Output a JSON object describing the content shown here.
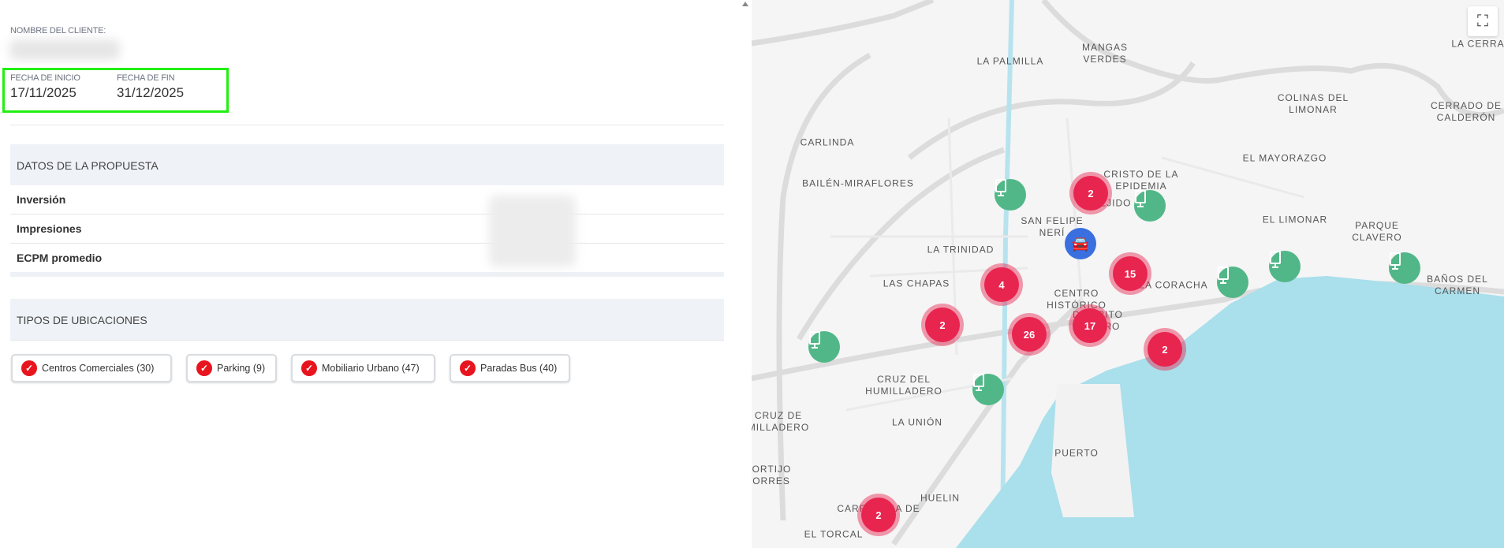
{
  "client": {
    "label": "NOMBRE DEL CLIENTE:"
  },
  "dates": {
    "start_label": "FECHA DE INICIO",
    "start_value": "17/11/2025",
    "end_label": "FECHA DE FIN",
    "end_value": "31/12/2025",
    "highlight_color": "#22ee11"
  },
  "proposal": {
    "title": "DATOS DE LA PROPUESTA",
    "rows": [
      {
        "label": "Inversión"
      },
      {
        "label": "Impresiones"
      },
      {
        "label": "ECPM promedio"
      }
    ]
  },
  "location_types": {
    "title": "TIPOS DE UBICACIONES",
    "chips": [
      {
        "label": "Centros Comerciales (30)",
        "checked": true
      },
      {
        "label": "Parking (9)",
        "checked": true
      },
      {
        "label": "Mobiliario Urbano (47)",
        "checked": true
      },
      {
        "label": "Paradas Bus (40)",
        "checked": true
      }
    ]
  },
  "map": {
    "labels": [
      "LA PALMILLA",
      "MANGAS VERDES",
      "CARLINDA",
      "BAILÉN-MIRAFLORES",
      "CRISTO DE LA EPIDEMIA",
      "EL EJIDO",
      "SAN FELIPE NERÍ",
      "LA TRINIDAD",
      "LAS CHAPAS",
      "CENTRO HISTÓRICO",
      "DISTRITO CENTRO",
      "LA CORACHA",
      "EL MAYORAZGO",
      "COLINAS DEL LIMONAR",
      "EL LIMONAR",
      "PARQUE CLAVERO",
      "CERRADO DE CALDERÓN",
      "LA CERRA",
      "BAÑOS DEL CARMEN",
      "CRUZ DEL HUMILLADERO",
      "LA UNIÓN",
      "CRUZ DE MILLADERO",
      "PUERTO",
      "HUELIN",
      "CARRETERA DE CÁDIZ",
      "EL TORCAL",
      "PORTIJO TORRES"
    ],
    "clusters": [
      "2",
      "15",
      "4",
      "2",
      "26",
      "17",
      "2",
      "2"
    ],
    "marker_colors": {
      "cluster": "#e8254f",
      "screen": "#52b788",
      "car": "#3a6fe0"
    },
    "sea_color": "#aadfec",
    "fullscreen_icon": "fullscreen-icon"
  }
}
